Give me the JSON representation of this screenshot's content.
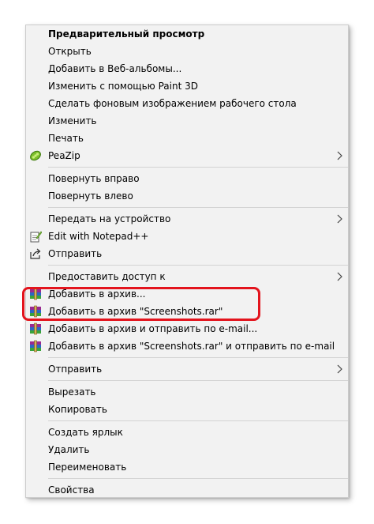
{
  "menu": {
    "items": [
      {
        "label": "Предварительный просмотр"
      },
      {
        "label": "Открыть"
      },
      {
        "label": "Добавить в Веб-альбомы..."
      },
      {
        "label": "Изменить с помощью Paint 3D"
      },
      {
        "label": "Сделать фоновым изображением рабочего стола"
      },
      {
        "label": "Изменить"
      },
      {
        "label": "Печать"
      },
      {
        "label": "PeaZip"
      },
      {
        "label": "Повернуть вправо"
      },
      {
        "label": "Повернуть влево"
      },
      {
        "label": "Передать на устройство"
      },
      {
        "label": "Edit with Notepad++"
      },
      {
        "label": "Отправить"
      },
      {
        "label": "Предоставить доступ к"
      },
      {
        "label": "Добавить в архив..."
      },
      {
        "label": "Добавить в архив \"Screenshots.rar\""
      },
      {
        "label": "Добавить в архив и отправить по e-mail..."
      },
      {
        "label": "Добавить в архив \"Screenshots.rar\" и отправить по e-mail"
      },
      {
        "label": "Отправить"
      },
      {
        "label": "Вырезать"
      },
      {
        "label": "Копировать"
      },
      {
        "label": "Создать ярлык"
      },
      {
        "label": "Удалить"
      },
      {
        "label": "Переименовать"
      },
      {
        "label": "Свойства"
      }
    ]
  },
  "colors": {
    "highlight": "#e3141d",
    "menu_bg": "#f2f2f2",
    "separator": "#d3d3d3"
  },
  "icons": {
    "peazip": "peazip-icon",
    "notepad": "notepad-plus-plus-icon",
    "share": "share-icon",
    "winrar": "winrar-archive-icon",
    "submenu": "chevron-right-icon"
  }
}
